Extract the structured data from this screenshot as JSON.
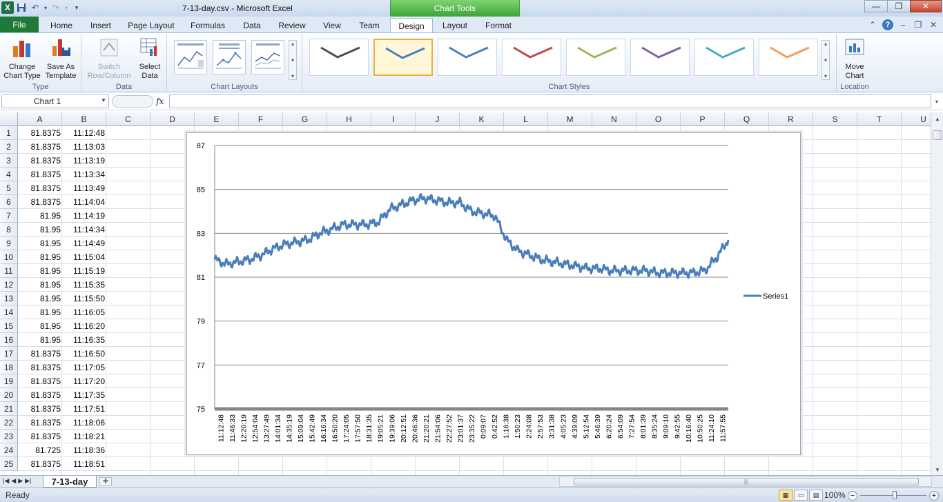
{
  "window": {
    "title": "7-13-day.csv  -  Microsoft Excel",
    "contextual_tab_group": "Chart Tools"
  },
  "ribbon_tabs": [
    "File",
    "Home",
    "Insert",
    "Page Layout",
    "Formulas",
    "Data",
    "Review",
    "View",
    "Team",
    "Design",
    "Layout",
    "Format"
  ],
  "active_tab": "Design",
  "groups": {
    "type": {
      "label": "Type",
      "change_chart_type": "Change\nChart Type",
      "save_as_template": "Save As\nTemplate"
    },
    "data": {
      "label": "Data",
      "switch_row_column": "Switch\nRow/Column",
      "select_data": "Select\nData"
    },
    "chart_layouts": {
      "label": "Chart Layouts"
    },
    "chart_styles": {
      "label": "Chart Styles",
      "style_colors": [
        "#4d4d4d",
        "#4a7ebb",
        "#4a7ebb",
        "#be4b48",
        "#98b954",
        "#7d60a0",
        "#46aac5",
        "#f59d56"
      ],
      "selected_index": 1
    },
    "location": {
      "label": "Location",
      "move_chart": "Move\nChart"
    }
  },
  "formula_bar": {
    "name_box": "Chart 1",
    "fx": "fx",
    "formula": ""
  },
  "columns": [
    "A",
    "B",
    "C",
    "D",
    "E",
    "F",
    "G",
    "H",
    "I",
    "J",
    "K",
    "L",
    "M",
    "N",
    "O",
    "P",
    "Q",
    "R",
    "S",
    "T",
    "U"
  ],
  "rows": [
    {
      "n": "1",
      "a": "81.8375",
      "b": "11:12:48"
    },
    {
      "n": "2",
      "a": "81.8375",
      "b": "11:13:03"
    },
    {
      "n": "3",
      "a": "81.8375",
      "b": "11:13:19"
    },
    {
      "n": "4",
      "a": "81.8375",
      "b": "11:13:34"
    },
    {
      "n": "5",
      "a": "81.8375",
      "b": "11:13:49"
    },
    {
      "n": "6",
      "a": "81.8375",
      "b": "11:14:04"
    },
    {
      "n": "7",
      "a": "81.95",
      "b": "11:14:19"
    },
    {
      "n": "8",
      "a": "81.95",
      "b": "11:14:34"
    },
    {
      "n": "9",
      "a": "81.95",
      "b": "11:14:49"
    },
    {
      "n": "10",
      "a": "81.95",
      "b": "11:15:04"
    },
    {
      "n": "11",
      "a": "81.95",
      "b": "11:15:19"
    },
    {
      "n": "12",
      "a": "81.95",
      "b": "11:15:35"
    },
    {
      "n": "13",
      "a": "81.95",
      "b": "11:15:50"
    },
    {
      "n": "14",
      "a": "81.95",
      "b": "11:16:05"
    },
    {
      "n": "15",
      "a": "81.95",
      "b": "11:16:20"
    },
    {
      "n": "16",
      "a": "81.95",
      "b": "11:16:35"
    },
    {
      "n": "17",
      "a": "81.8375",
      "b": "11:16:50"
    },
    {
      "n": "18",
      "a": "81.8375",
      "b": "11:17:05"
    },
    {
      "n": "19",
      "a": "81.8375",
      "b": "11:17:20"
    },
    {
      "n": "20",
      "a": "81.8375",
      "b": "11:17:35"
    },
    {
      "n": "21",
      "a": "81.8375",
      "b": "11:17:51"
    },
    {
      "n": "22",
      "a": "81.8375",
      "b": "11:18:06"
    },
    {
      "n": "23",
      "a": "81.8375",
      "b": "11:18:21"
    },
    {
      "n": "24",
      "a": "81.725",
      "b": "11:18:36"
    },
    {
      "n": "25",
      "a": "81.8375",
      "b": "11:18:51"
    }
  ],
  "chart_data": {
    "type": "line",
    "title": "",
    "ylim": [
      75,
      87
    ],
    "yticks": [
      "75",
      "77",
      "79",
      "81",
      "83",
      "85",
      "87"
    ],
    "grid": true,
    "legend_position": "right",
    "categories": [
      "11:12:48",
      "11:46:33",
      "12:20:19",
      "12:54:04",
      "13:27:49",
      "14:01:34",
      "14:35:19",
      "15:09:04",
      "15:42:49",
      "16:16:34",
      "16:50:20",
      "17:24:05",
      "17:57:50",
      "18:31:35",
      "19:05:21",
      "19:39:06",
      "20:12:51",
      "20:46:36",
      "21:20:21",
      "21:54:06",
      "22:27:52",
      "23:01:37",
      "23:35:22",
      "0:09:07",
      "0:42:52",
      "1:16:38",
      "1:50:23",
      "2:24:08",
      "2:57:53",
      "3:31:38",
      "4:05:23",
      "4:39:09",
      "5:12:54",
      "5:46:39",
      "6:20:24",
      "6:54:09",
      "7:27:54",
      "8:01:39",
      "8:35:24",
      "9:09:10",
      "9:42:55",
      "10:16:40",
      "10:50:25",
      "11:24:10",
      "11:57:55"
    ],
    "series": [
      {
        "name": "Series1",
        "color": "#4a7ebb",
        "values": [
          81.8,
          81.6,
          81.7,
          81.8,
          82.0,
          82.3,
          82.5,
          82.6,
          82.7,
          83.0,
          83.2,
          83.4,
          83.4,
          83.4,
          83.5,
          84.1,
          84.3,
          84.5,
          84.6,
          84.5,
          84.4,
          84.4,
          84.0,
          83.9,
          83.8,
          82.7,
          82.2,
          82.0,
          81.8,
          81.7,
          81.6,
          81.5,
          81.4,
          81.4,
          81.3,
          81.3,
          81.3,
          81.3,
          81.2,
          81.2,
          81.2,
          81.2,
          81.3,
          81.9,
          82.7
        ]
      }
    ]
  },
  "sheet_tabs": [
    "7-13-day"
  ],
  "status": {
    "ready": "Ready",
    "zoom": "100%"
  }
}
